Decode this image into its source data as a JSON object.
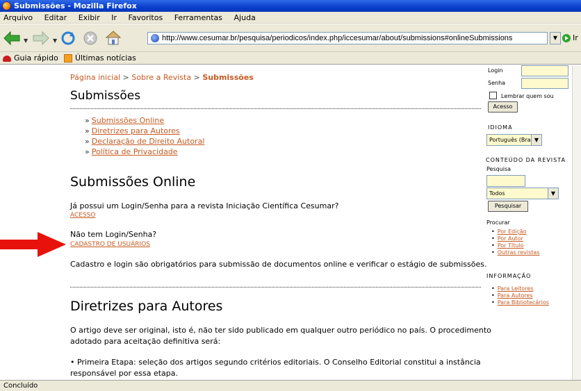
{
  "window": {
    "title": "Submissões - Mozilla Firefox"
  },
  "menubar": {
    "items": [
      "Arquivo",
      "Editar",
      "Exibir",
      "Ir",
      "Favoritos",
      "Ferramentas",
      "Ajuda"
    ]
  },
  "navbar": {
    "url": "http://www.cesumar.br/pesquisa/periodicos/index.php/iccesumar/about/submissions#onlineSubmissions",
    "go_label": "Ir"
  },
  "bookmarks": {
    "items": [
      "Guia rápido",
      "Últimas notícias"
    ]
  },
  "breadcrumb": {
    "home": "Página inicial",
    "about": "Sobre a Revista",
    "current": "Submissões",
    "separator": ">"
  },
  "page": {
    "title": "Submissões",
    "toc": [
      "Submissões Online",
      "Diretrizes para Autores",
      "Declaração de Direito Autoral",
      "Política de Privacidade"
    ],
    "online_heading": "Submissões Online",
    "login_question": "Já possui um Login/Senha para a revista Iniciação Científica Cesumar?",
    "acesso_link": "ACESSO",
    "no_login": "Não tem Login/Senha?",
    "cadastro_link": "CADASTRO DE USUÁRIOS",
    "required_note": "Cadastro e login são obrigatórios para submissão de documentos online e verificar o estágio de submissões.",
    "diretrizes_heading": "Diretrizes para Autores",
    "diretrizes_p1": "O artigo deve ser original, isto é, não ter sido publicado em qualquer outro periódico no país. O procedimento adotado para aceitação definitiva será:",
    "diretrizes_p2": "• Primeira Etapa: seleção dos artigos segundo critérios editoriais. O Conselho Editorial constitui a instância responsável por essa etapa."
  },
  "sidebar": {
    "login_label": "Login",
    "senha_label": "Senha",
    "remember_label": "Lembrar quem sou",
    "acesso_button": "Acesso",
    "idioma_heading": "IDIOMA",
    "idioma_value": "Português (Brasil)",
    "conteudo_heading": "CONTEÚDO DA REVISTA",
    "pesquisa_label": "Pesquisa",
    "scope_value": "Todos",
    "pesquisar_button": "Pesquisar",
    "procurar_label": "Procurar",
    "procurar_links": [
      "Por Edição",
      "Por Autor",
      "Por Título",
      "Outras revistas"
    ],
    "informacao_heading": "INFORMAÇÃO",
    "info_links": [
      "Para Leitores",
      "Para Autores",
      "Para Bibliotecários"
    ]
  },
  "status": {
    "text": "Concluído"
  },
  "colors": {
    "link": "#c45a21",
    "arrow": "#e8120c",
    "titlebar": "#0a3fcc"
  }
}
